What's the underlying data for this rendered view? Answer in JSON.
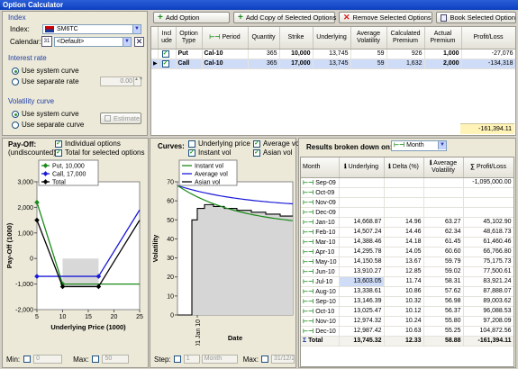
{
  "window": {
    "title": "Option Calculator"
  },
  "index_group": {
    "title": "Index",
    "index_label": "Index:",
    "index_value": "SM6TC",
    "calendar_label": "Calendar:",
    "calendar_value": "<Default>"
  },
  "interest_group": {
    "title": "Interest rate",
    "opt1": "Use system curve",
    "opt2": "Use separate rate",
    "rate_value": "0.00"
  },
  "vol_group": {
    "title": "Volatility curve",
    "opt1": "Use system curve",
    "opt2": "Use separate curve",
    "estimate_label": "Estimate"
  },
  "toolbar": {
    "add": "Add Option",
    "add_copy": "Add Copy of Selected Options",
    "remove": "Remove Selected Options",
    "book": "Book Selected Option"
  },
  "options_table": {
    "headers": [
      "Incl ude",
      "Option Type",
      "Period",
      "Quantity",
      "Strike",
      "Underlying",
      "Average Volatility",
      "Calculated Premium",
      "Actual Premium",
      "Profit/Loss"
    ],
    "rows": [
      {
        "type": "Put",
        "period": "Cal-10",
        "qty": "365",
        "strike": "10,000",
        "underlying": "13,745",
        "vol": "59",
        "calc": "926",
        "actual": "1,000",
        "pl": "-27,076"
      },
      {
        "type": "Call",
        "period": "Cal-10",
        "qty": "365",
        "strike": "17,000",
        "underlying": "13,745",
        "vol": "59",
        "calc": "1,632",
        "actual": "2,000",
        "pl": "-134,318"
      }
    ],
    "total": "-161,394.11"
  },
  "payoff": {
    "title": "Pay-Off:",
    "subtitle": "(undiscounted)",
    "cb_individual": "Individual options",
    "cb_total": "Total for selected options",
    "min_label": "Min:",
    "min_value": "0",
    "max_label": "Max:",
    "max_value": "50"
  },
  "curves": {
    "title": "Curves:",
    "cb_underlying": "Underlying price",
    "cb_instant": "Instant vol",
    "cb_avg": "Average vol",
    "cb_asian": "Asian vol",
    "step_label": "Step:",
    "step_value": "1",
    "step_unit": "Month",
    "max_label": "Max:",
    "max_value": "31/12/2"
  },
  "results": {
    "title": "Results broken down on:",
    "breakdown": "Month",
    "headers": [
      "Month",
      "Underlying",
      "Delta (%)",
      "Average Volatility",
      "Profit/Loss"
    ],
    "rows": [
      {
        "m": "Sep-09",
        "u": "",
        "d": "",
        "v": "",
        "pl": "-1,095,000.00"
      },
      {
        "m": "Oct-09",
        "u": "",
        "d": "",
        "v": "",
        "pl": ""
      },
      {
        "m": "Nov-09",
        "u": "",
        "d": "",
        "v": "",
        "pl": ""
      },
      {
        "m": "Dec-09",
        "u": "",
        "d": "",
        "v": "",
        "pl": ""
      },
      {
        "m": "Jan-10",
        "u": "14,668.87",
        "d": "14.96",
        "v": "63.27",
        "pl": "45,102.90"
      },
      {
        "m": "Feb-10",
        "u": "14,507.24",
        "d": "14.46",
        "v": "62.34",
        "pl": "48,618.73"
      },
      {
        "m": "Mar-10",
        "u": "14,388.46",
        "d": "14.18",
        "v": "61.45",
        "pl": "61,460.46"
      },
      {
        "m": "Apr-10",
        "u": "14,295.78",
        "d": "14.05",
        "v": "60.60",
        "pl": "66,766.80"
      },
      {
        "m": "May-10",
        "u": "14,150.58",
        "d": "13.67",
        "v": "59.79",
        "pl": "75,175.73"
      },
      {
        "m": "Jun-10",
        "u": "13,910.27",
        "d": "12.85",
        "v": "59.02",
        "pl": "77,500.61"
      },
      {
        "m": "Jul-10",
        "u": "13,603.05",
        "d": "11.74",
        "v": "58.31",
        "pl": "83,921.24"
      },
      {
        "m": "Aug-10",
        "u": "13,338.61",
        "d": "10.86",
        "v": "57.62",
        "pl": "87,888.07"
      },
      {
        "m": "Sep-10",
        "u": "13,146.39",
        "d": "10.32",
        "v": "56.98",
        "pl": "89,003.62"
      },
      {
        "m": "Oct-10",
        "u": "13,025.47",
        "d": "10.12",
        "v": "56.37",
        "pl": "96,088.53"
      },
      {
        "m": "Nov-10",
        "u": "12,974.32",
        "d": "10.24",
        "v": "55.80",
        "pl": "97,208.09"
      },
      {
        "m": "Dec-10",
        "u": "12,987.42",
        "d": "10.63",
        "v": "55.25",
        "pl": "104,872.56"
      }
    ],
    "total": {
      "m": "Total",
      "u": "13,745.32",
      "d": "12.33",
      "v": "58.88",
      "pl": "-161,394.11"
    }
  },
  "chart_data": [
    {
      "type": "line",
      "ylabel": "Pay-Off (1000)",
      "xlabel": "Underlying Price (1000)",
      "ylim": [
        -2000,
        3000
      ],
      "xlim": [
        5,
        25
      ],
      "yticks": [
        "3,000",
        "2,000",
        "1,000",
        "0",
        "-1,000",
        "-2,000"
      ],
      "xticks": [
        "5",
        "10",
        "15",
        "20",
        "25"
      ],
      "series": [
        {
          "name": "Put, 10,000",
          "color": "#1a8a1a",
          "x": [
            5,
            10,
            25
          ],
          "y": [
            2195,
            -1000,
            -1000
          ]
        },
        {
          "name": "Call, 17,000",
          "color": "#1a1ad8",
          "x": [
            5,
            17,
            25
          ],
          "y": [
            -700,
            -700,
            1900
          ]
        },
        {
          "name": "Total",
          "color": "#000000",
          "x": [
            5,
            10,
            17,
            25
          ],
          "y": [
            1500,
            -1100,
            -1100,
            1500
          ]
        }
      ]
    },
    {
      "type": "line",
      "ylabel": "Volatility",
      "xlabel": "Date",
      "ylim": [
        0,
        70
      ],
      "yticks": [
        "70",
        "60",
        "50",
        "40",
        "30",
        "20",
        "10",
        "0"
      ],
      "xticks": [
        "01 Jan 10"
      ],
      "series": [
        {
          "name": "Instant vol",
          "color": "#1a8a1a"
        },
        {
          "name": "Average vol",
          "color": "#1a1ad8"
        },
        {
          "name": "Asian vol",
          "color": "#000000"
        }
      ]
    }
  ]
}
